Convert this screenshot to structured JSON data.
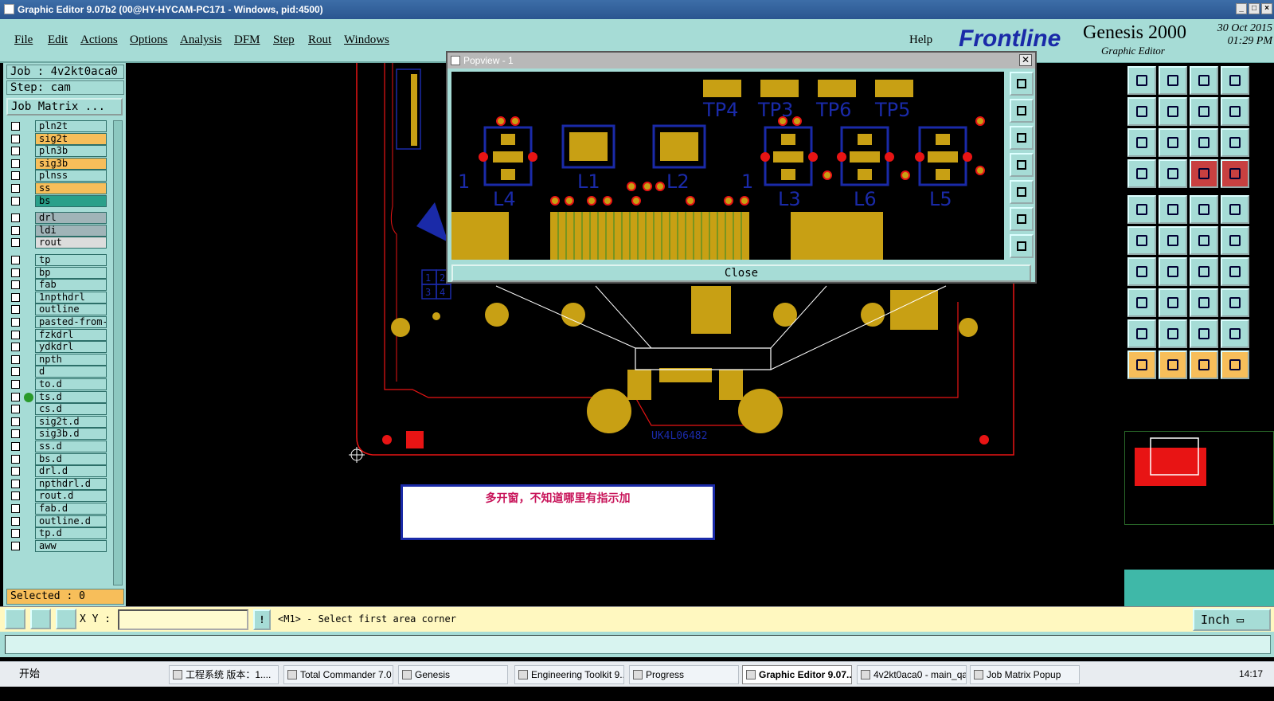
{
  "window": {
    "title": "Graphic Editor 9.07b2 (00@HY-HYCAM-PC171 - Windows, pid:4500)",
    "controls": [
      "_",
      "□",
      "×"
    ]
  },
  "menu": {
    "items": [
      "File",
      "Edit",
      "Actions",
      "Options",
      "Analysis",
      "DFM",
      "Step",
      "Rout",
      "Windows"
    ],
    "help": "Help"
  },
  "logo": {
    "brand": "Frontline",
    "product": "Genesis 2000",
    "subtitle": "Graphic Editor",
    "date": "30 Oct 2015",
    "time": "01:29 PM"
  },
  "left": {
    "job": "Job : 4v2kt0aca0",
    "step": "Step: cam",
    "job_matrix": "Job Matrix ...",
    "selected": "Selected : 0",
    "layers": [
      {
        "name": "pln2t",
        "color": "#a6dcd6"
      },
      {
        "name": "sig2t",
        "color": "#f7be5a"
      },
      {
        "name": "pln3b",
        "color": "#a6dcd6"
      },
      {
        "name": "sig3b",
        "color": "#f7be5a"
      },
      {
        "name": "plnss",
        "color": "#a6dcd6"
      },
      {
        "name": "ss",
        "color": "#f7be5a"
      },
      {
        "name": "bs",
        "color": "#2aa08a"
      },
      {
        "name": "drl",
        "color": "#a0b4b8"
      },
      {
        "name": "ldi",
        "color": "#a0b4b8"
      },
      {
        "name": "rout",
        "color": "#dcdcdc"
      },
      {
        "name": "tp",
        "color": "#a6dcd6"
      },
      {
        "name": "bp",
        "color": "#a6dcd6"
      },
      {
        "name": "fab",
        "color": "#a6dcd6"
      },
      {
        "name": "1npthdrl",
        "color": "#a6dcd6"
      },
      {
        "name": "outline",
        "color": "#a6dcd6"
      },
      {
        "name": "pasted-from-",
        "color": "#a6dcd6"
      },
      {
        "name": "fzkdrl",
        "color": "#a6dcd6"
      },
      {
        "name": "ydkdrl",
        "color": "#a6dcd6"
      },
      {
        "name": "npth",
        "color": "#a6dcd6"
      },
      {
        "name": "d",
        "color": "#a6dcd6"
      },
      {
        "name": "to.d",
        "color": "#a6dcd6"
      },
      {
        "name": "ts.d",
        "color": "#a6dcd6"
      },
      {
        "name": "cs.d",
        "color": "#a6dcd6"
      },
      {
        "name": "sig2t.d",
        "color": "#a6dcd6"
      },
      {
        "name": "sig3b.d",
        "color": "#a6dcd6"
      },
      {
        "name": "ss.d",
        "color": "#a6dcd6"
      },
      {
        "name": "bs.d",
        "color": "#a6dcd6"
      },
      {
        "name": "drl.d",
        "color": "#a6dcd6"
      },
      {
        "name": "npthdrl.d",
        "color": "#a6dcd6"
      },
      {
        "name": "rout.d",
        "color": "#a6dcd6"
      },
      {
        "name": "fab.d",
        "color": "#a6dcd6"
      },
      {
        "name": "outline.d",
        "color": "#a6dcd6"
      },
      {
        "name": "tp.d",
        "color": "#a6dcd6"
      },
      {
        "name": "aww",
        "color": "#a6dcd6"
      }
    ]
  },
  "popview": {
    "title": "Popview - 1",
    "close": "Close",
    "labels": [
      "TP4",
      "TP3",
      "TP6",
      "TP5",
      "L4",
      "L1",
      "L2",
      "L3",
      "L6",
      "L5",
      "1",
      "1"
    ]
  },
  "canvas": {
    "board_label": "UK4L06482",
    "grid_cells": [
      "1",
      "2",
      "3",
      "4"
    ]
  },
  "annotation": "多开窗，不知道哪里有指示加",
  "xy": {
    "label": "X Y :",
    "value": "",
    "message": "<M1> - Select first area corner",
    "unit": "Inch"
  },
  "taskbar": {
    "start": "开始",
    "tasks": [
      "工程系统  版本：1....",
      "Total Commander 7.0 ...",
      "Genesis",
      "Engineering Toolkit 9....",
      "Progress",
      "Graphic Editor 9.07...",
      "4v2kt0aca0 - main_qa",
      "Job Matrix Popup"
    ],
    "active": "Graphic Editor 9.07...",
    "clock": "14:17"
  },
  "colors": {
    "panel": "#a6dcd6",
    "copper": "#c8a014",
    "outline": "#1a2aa8",
    "pad": "#e81414"
  }
}
